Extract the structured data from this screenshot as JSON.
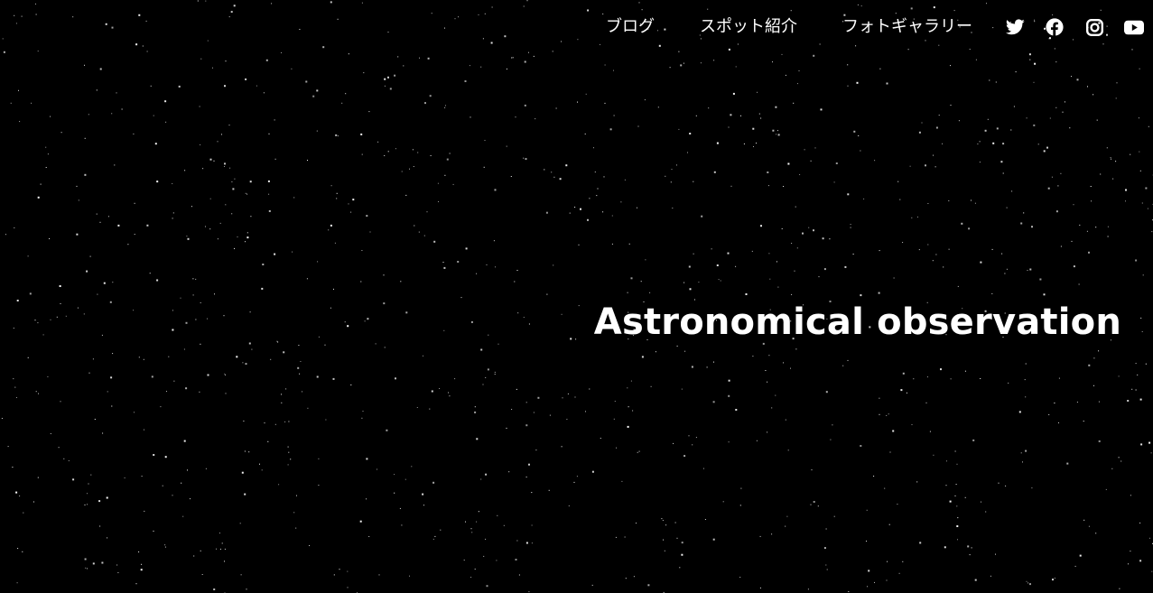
{
  "nav": {
    "links": [
      {
        "label": "ブログ"
      },
      {
        "label": "スポット紹介"
      },
      {
        "label": "フォトギャラリー"
      }
    ],
    "social": [
      {
        "icon": "twitter-icon"
      },
      {
        "icon": "facebook-icon"
      },
      {
        "icon": "instagram-icon"
      },
      {
        "icon": "youtube-icon"
      }
    ]
  },
  "hero": {
    "title": "Astronomical observation"
  },
  "colors": {
    "background": "#000000",
    "text": "#ffffff",
    "stars": "#ffffff"
  }
}
